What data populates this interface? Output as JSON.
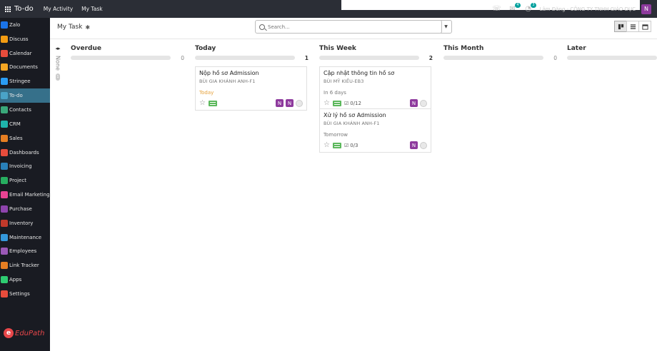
{
  "topbar": {
    "app_title": "To-do",
    "nav": [
      "My Activity",
      "My Task"
    ],
    "messages_badge": "4",
    "activity_badge": "3",
    "company": "Lâm Đăng - CÔNG TY TNHH GIÁO DỤC",
    "user_initial": "N"
  },
  "sidebar": {
    "items": [
      {
        "label": "Zalo",
        "color": "#1a73e8"
      },
      {
        "label": "Discuss",
        "color": "#f39c12"
      },
      {
        "label": "Calendar",
        "color": "#e74c3c"
      },
      {
        "label": "Documents",
        "color": "#f5a623"
      },
      {
        "label": "Stringee",
        "color": "#2a9df4"
      },
      {
        "label": "To-do",
        "color": "#4aa3c7"
      },
      {
        "label": "Contacts",
        "color": "#3aa87a"
      },
      {
        "label": "CRM",
        "color": "#1fb5ad"
      },
      {
        "label": "Sales",
        "color": "#e67e22"
      },
      {
        "label": "Dashboards",
        "color": "#e74c3c"
      },
      {
        "label": "Invoicing",
        "color": "#2980b9"
      },
      {
        "label": "Project",
        "color": "#27ae60"
      },
      {
        "label": "Email Marketing",
        "color": "#e84393"
      },
      {
        "label": "Purchase",
        "color": "#8e44ad"
      },
      {
        "label": "Inventory",
        "color": "#c0392b"
      },
      {
        "label": "Maintenance",
        "color": "#3498db"
      },
      {
        "label": "Employees",
        "color": "#9b59b6"
      },
      {
        "label": "Link Tracker",
        "color": "#e67e22"
      },
      {
        "label": "Apps",
        "color": "#2ecc71"
      },
      {
        "label": "Settings",
        "color": "#e74c3c"
      }
    ],
    "active_index": 5,
    "logo_text": "EduPath"
  },
  "control": {
    "page_title": "My Task",
    "search_placeholder": "Search..."
  },
  "kanban": {
    "folded_label": "None",
    "folded_count": "1",
    "columns": [
      {
        "title": "Overdue",
        "count": "0"
      },
      {
        "title": "Today",
        "count": "1"
      },
      {
        "title": "This Week",
        "count": "2"
      },
      {
        "title": "This Month",
        "count": "0"
      },
      {
        "title": "Later",
        "count": ""
      }
    ],
    "cards": [
      {
        "title": "Nộp hồ sơ Admission",
        "assignee": "BÙI GIA KHÁNH ANH-F1",
        "deadline": "Today",
        "checklist": "",
        "avatars": [
          "N",
          "N"
        ]
      },
      {
        "title": "Cập nhật thông tin hồ sơ",
        "assignee": "BÙI MỸ KIỀU-EB3",
        "deadline": "In 6 days",
        "checklist": "0/12",
        "avatars": [
          "N"
        ]
      },
      {
        "title": "Xử lý hồ sơ Admission",
        "assignee": "BÙI GIA KHÁNH ANH-F1",
        "deadline": "Tomorrow",
        "checklist": "0/3",
        "avatars": [
          "N"
        ]
      }
    ]
  }
}
